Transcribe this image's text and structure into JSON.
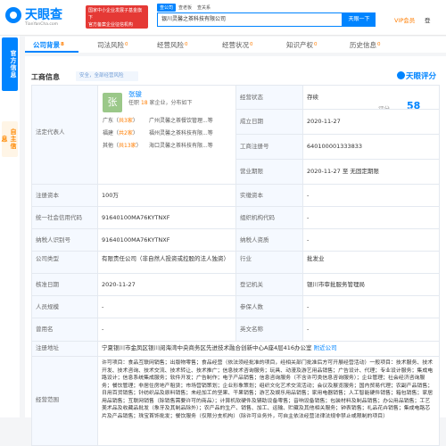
{
  "site": {
    "logo_name": "天眼查",
    "logo_url": "TianYanCha.com",
    "banner_line1": "国家中小企业发展子基金旗下",
    "banner_line2": "官方备案企业征信机构"
  },
  "search": {
    "tabs": [
      "查公司",
      "查老板",
      "查关系"
    ],
    "value": "银川灵馨之茶科技有限公司",
    "button": "天眼一下"
  },
  "header": {
    "vip": "VIP会员",
    "login": "登"
  },
  "side": {
    "tab1": "官方信息",
    "tab2": "自主信息"
  },
  "nav": [
    {
      "label": "公司背景",
      "count": "8"
    },
    {
      "label": "司法风险",
      "count": "0"
    },
    {
      "label": "经营风险",
      "count": "0"
    },
    {
      "label": "经营状况",
      "count": "0"
    },
    {
      "label": "知识产权",
      "count": "0"
    },
    {
      "label": "历史信息",
      "count": "0"
    }
  ],
  "panel": {
    "title": "工商信息",
    "safe_badge": "安全，全部经营风险",
    "brand": "天眼评分"
  },
  "legal": {
    "label": "法定代表人",
    "avatar_char": "张",
    "name": "张骏",
    "info_pre": "任职",
    "info_count": "18",
    "info_post": "家企业，分布如下",
    "holdings": [
      {
        "region": "广东",
        "count": "共3家",
        "company": "广州灵馨之茶餐饮管理...等"
      },
      {
        "region": "福建",
        "count": "共2家",
        "company": "福州灵馨之茶科技有限...等"
      },
      {
        "region": "其他",
        "count": "共13家",
        "company": "海口灵馨之茶科技有限...等"
      }
    ]
  },
  "right_top": [
    {
      "label": "经营状态",
      "value": "存续"
    },
    {
      "label": "成立日期",
      "value": "2020-11-27"
    },
    {
      "label": "工商注册号",
      "value": "640100001333833"
    },
    {
      "label": "营业期限",
      "value": "2020-11-27  至  无固定期限"
    }
  ],
  "score": {
    "label": "评分",
    "value": "58"
  },
  "rows": [
    {
      "l1": "注册资本",
      "v1": "100万",
      "l2": "实缴资本",
      "v2": "-"
    },
    {
      "l1": "统一社会信用代码",
      "v1": "91640100MA76KYTNXF",
      "l2": "组织机构代码",
      "v2": "-"
    },
    {
      "l1": "纳税人识别号",
      "v1": "91640100MA76KYTNXF",
      "l2": "纳税人资质",
      "v2": "-"
    },
    {
      "l1": "公司类型",
      "v1": "有限责任公司（非自然人投资或控股的法人独资）",
      "l2": "行业",
      "v2": "批发业"
    },
    {
      "l1": "核准日期",
      "v1": "2020-11-27",
      "l2": "登记机关",
      "v2": "银川市审批服务管理局"
    },
    {
      "l1": "人员规模",
      "v1": "-",
      "l2": "参保人数",
      "v2": "-"
    },
    {
      "l1": "曾用名",
      "v1": "-",
      "l2": "英文名称",
      "v2": "-"
    }
  ],
  "address": {
    "label": "注册地址",
    "value": "宁夏银川市金凤区银川阅海湾中央商务区先进技术融合创新中心A座4层416办公室",
    "link": "附近公司"
  },
  "scope": {
    "label": "经营范围",
    "value": "许可项目：食品互联网销售；出版物零售；食品经营（依法须经批准的项目，经相关部门批准后方可开展经营活动）一般项目：技术服务、技术开发、技术咨询、技术交流、技术转让、技术推广；信息技术咨询服务；玩具、动漫及游艺用品销售；广告设计、代理；专业设计服务；集成电路设计；信息系统集成服务；软件开发；广告制作；电子产品销售；信息咨询服务（不含许可类信息咨询服务）；企业管理；社会经济咨询服务；餐饮管理；非居住房地产租赁；市场营销策划；企业形象策划；组织文化艺术交流活动；会议及展览服务；国内贸易代理；农副产品销售；日用百货销售；针纺织品及原料销售；未经加工的坚果、干果销售；游艺及娱乐用品销售；家用电器销售；人工智能硬件销售；箱包销售；家居用品销售；互联网销售（除销售需要许可的商品）；计算机软硬件及辅助设备零售；音响设备销售；包装材料及制品销售；办公用品销售；工艺美术品及收藏品批发（象牙及其制品除外）；农产品的生产、销售、加工、运输、贮藏及其他相关服务；钟表销售；礼品花卉销售；集成电路芯片及产品销售；珠宝首饰批发；餐饮服务（仅限分支机构）（除许可业务外，可自主依法经营法律法规非禁止或限制的项目）"
  }
}
